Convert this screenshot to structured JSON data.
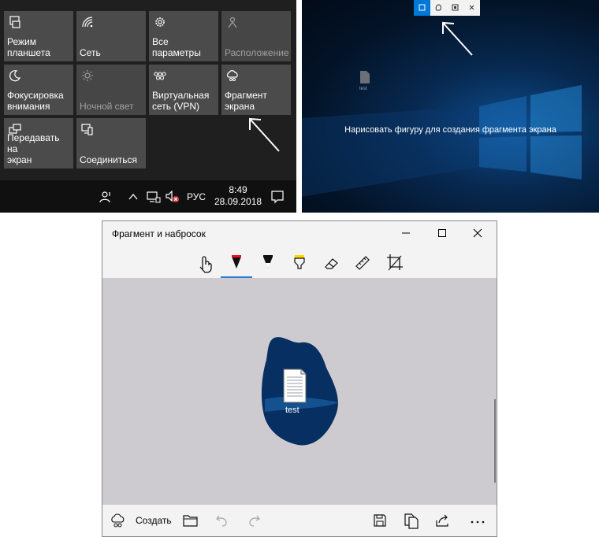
{
  "action_center": {
    "tiles": [
      {
        "label": "Режим\nпланшета",
        "icon": "tablet-mode-icon",
        "enabled": true
      },
      {
        "label": "Сеть",
        "icon": "wifi-icon",
        "enabled": true
      },
      {
        "label": "Все параметры",
        "icon": "gear-icon",
        "enabled": true
      },
      {
        "label": "Расположение",
        "icon": "location-icon",
        "enabled": false
      },
      {
        "label": "Фокусировка\nвнимания",
        "icon": "moon-icon",
        "enabled": true
      },
      {
        "label": "Ночной свет",
        "icon": "brightness-icon",
        "enabled": false
      },
      {
        "label": "Виртуальная\nсеть (VPN)",
        "icon": "vpn-icon",
        "enabled": true
      },
      {
        "label": "Фрагмент\nэкрана",
        "icon": "screen-snip-icon",
        "enabled": true
      },
      {
        "label": "Передавать на\nэкран",
        "icon": "project-icon",
        "enabled": true
      },
      {
        "label": "Соединиться",
        "icon": "connect-icon",
        "enabled": true
      }
    ],
    "taskbar": {
      "language": "РУС",
      "time": "8:49",
      "date": "28.09.2018"
    }
  },
  "desktop": {
    "prompt": "Нарисовать фигуру для создания фрагмента экрана",
    "file_label": "test",
    "snip_modes": [
      "rectangular-snip-icon",
      "freeform-snip-icon",
      "window-snip-icon",
      "close-icon"
    ]
  },
  "snip_window": {
    "title": "Фрагмент и набросок",
    "tools": [
      "touch-writing-icon",
      "ballpoint-pen-icon",
      "pencil-icon",
      "highlighter-icon",
      "eraser-icon",
      "ruler-icon",
      "crop-icon"
    ],
    "create_label": "Создать",
    "file_label": "test",
    "accent_color": "#2d7dd2"
  }
}
